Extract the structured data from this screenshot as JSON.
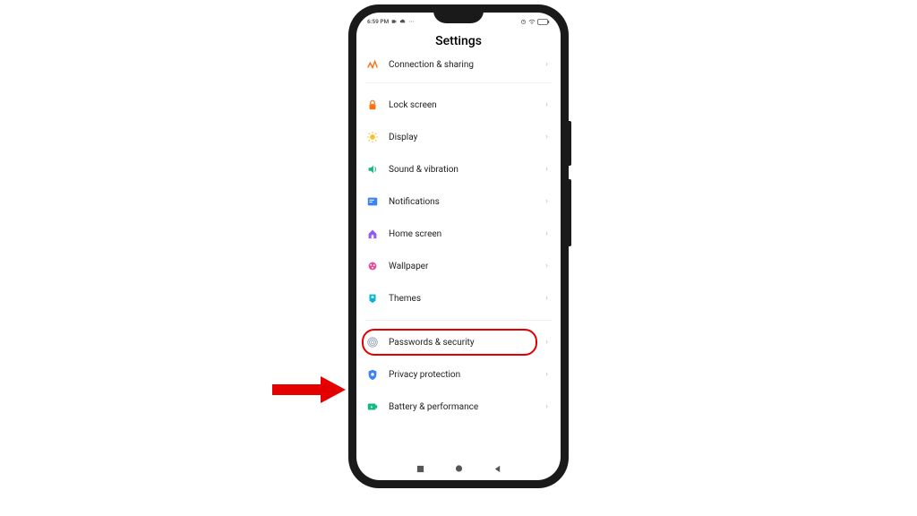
{
  "status": {
    "time": "6:59 PM"
  },
  "page": {
    "title": "Settings"
  },
  "rows": {
    "connection": {
      "label": "Connection & sharing"
    },
    "lock_screen": {
      "label": "Lock screen"
    },
    "display": {
      "label": "Display"
    },
    "sound": {
      "label": "Sound & vibration"
    },
    "notifications": {
      "label": "Notifications"
    },
    "home": {
      "label": "Home screen"
    },
    "wallpaper": {
      "label": "Wallpaper"
    },
    "themes": {
      "label": "Themes"
    },
    "passwords": {
      "label": "Passwords & security"
    },
    "privacy": {
      "label": "Privacy protection"
    },
    "battery": {
      "label": "Battery & performance"
    }
  }
}
